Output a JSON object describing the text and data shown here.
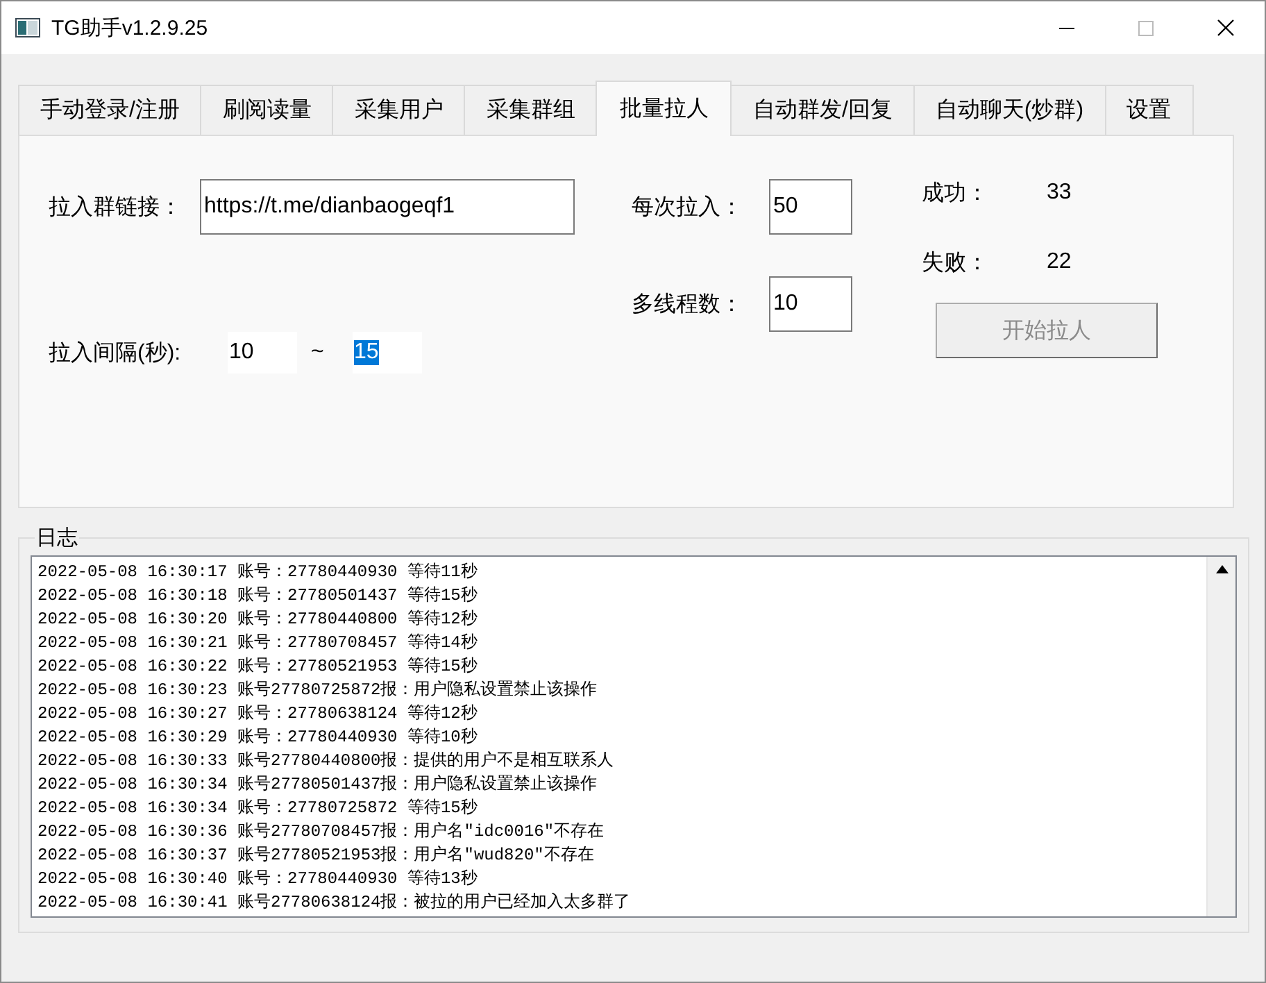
{
  "window": {
    "title": "TG助手v1.2.9.25"
  },
  "tabs": [
    {
      "label": "手动登录/注册",
      "selected": false
    },
    {
      "label": "刷阅读量",
      "selected": false
    },
    {
      "label": "采集用户",
      "selected": false
    },
    {
      "label": "采集群组",
      "selected": false
    },
    {
      "label": "批量拉人",
      "selected": true
    },
    {
      "label": "自动群发/回复",
      "selected": false
    },
    {
      "label": "自动聊天(炒群)",
      "selected": false
    },
    {
      "label": "设置",
      "selected": false
    }
  ],
  "form": {
    "group_link": {
      "label": "拉入群链接：",
      "value": "https://t.me/dianbaogeqf1"
    },
    "per_batch": {
      "label": "每次拉入：",
      "value": "50"
    },
    "threads": {
      "label": "多线程数：",
      "value": "10"
    },
    "interval": {
      "label": "拉入间隔(秒):",
      "from": "10",
      "separator": "~",
      "to": "15",
      "to_selected": true
    },
    "success": {
      "label": "成功：",
      "value": "33"
    },
    "failure": {
      "label": "失败：",
      "value": "22"
    },
    "start_button": {
      "label": "开始拉人",
      "disabled": true
    }
  },
  "log": {
    "title": "日志",
    "lines": [
      "2022-05-08 16:30:17 账号：27780440930 等待11秒",
      "2022-05-08 16:30:18 账号：27780501437 等待15秒",
      "2022-05-08 16:30:20 账号：27780440800 等待12秒",
      "2022-05-08 16:30:21 账号：27780708457 等待14秒",
      "2022-05-08 16:30:22 账号：27780521953 等待15秒",
      "2022-05-08 16:30:23 账号27780725872报：用户隐私设置禁止该操作",
      "2022-05-08 16:30:27 账号：27780638124 等待12秒",
      "2022-05-08 16:30:29 账号：27780440930 等待10秒",
      "2022-05-08 16:30:33 账号27780440800报：提供的用户不是相互联系人",
      "2022-05-08 16:30:34 账号27780501437报：用户隐私设置禁止该操作",
      "2022-05-08 16:30:34 账号：27780725872 等待15秒",
      "2022-05-08 16:30:36 账号27780708457报：用户名\"idc0016\"不存在",
      "2022-05-08 16:30:37 账号27780521953报：用户名\"wud820\"不存在",
      "2022-05-08 16:30:40 账号：27780440930 等待13秒",
      "2022-05-08 16:30:41 账号27780638124报：被拉的用户已经加入太多群了"
    ]
  }
}
